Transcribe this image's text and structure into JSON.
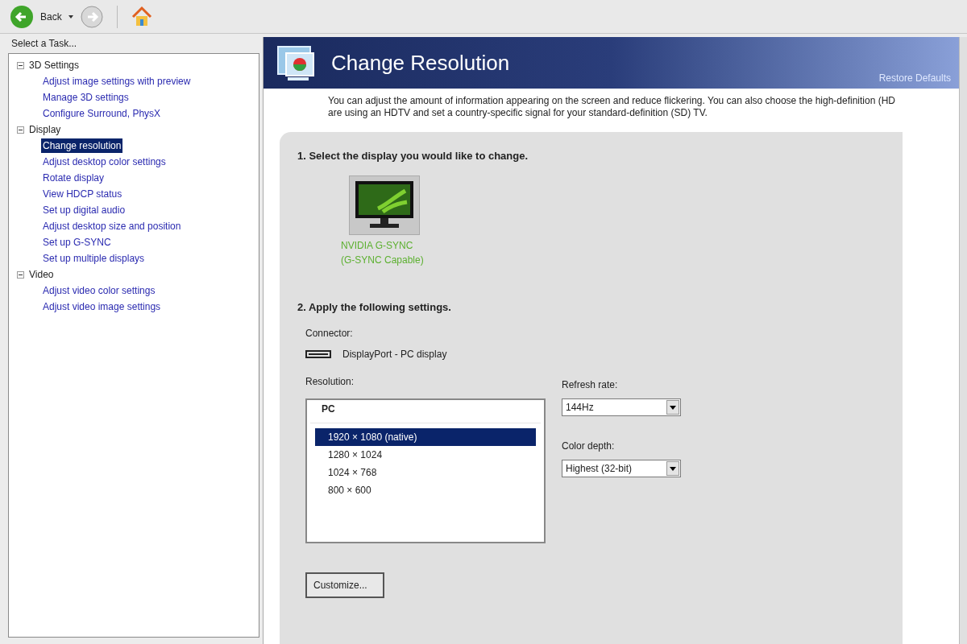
{
  "toolbar": {
    "back_label": "Back"
  },
  "task_panel": {
    "title": "Select a Task...",
    "tree": [
      {
        "label": "3D Settings",
        "expanded": true,
        "children": [
          {
            "label": "Adjust image settings with preview",
            "selected": false
          },
          {
            "label": "Manage 3D settings",
            "selected": false
          },
          {
            "label": "Configure Surround, PhysX",
            "selected": false
          }
        ]
      },
      {
        "label": "Display",
        "expanded": true,
        "children": [
          {
            "label": "Change resolution",
            "selected": true
          },
          {
            "label": "Adjust desktop color settings",
            "selected": false
          },
          {
            "label": "Rotate display",
            "selected": false
          },
          {
            "label": "View HDCP status",
            "selected": false
          },
          {
            "label": "Set up digital audio",
            "selected": false
          },
          {
            "label": "Adjust desktop size and position",
            "selected": false
          },
          {
            "label": "Set up G-SYNC",
            "selected": false
          },
          {
            "label": "Set up multiple displays",
            "selected": false
          }
        ]
      },
      {
        "label": "Video",
        "expanded": true,
        "children": [
          {
            "label": "Adjust video color settings",
            "selected": false
          },
          {
            "label": "Adjust video image settings",
            "selected": false
          }
        ]
      }
    ]
  },
  "page": {
    "title": "Change Resolution",
    "restore_link": "Restore Defaults",
    "description": [
      "You can adjust the amount of information appearing on the screen and reduce flickering. You can also choose the high-definition (HD",
      "are using an HDTV and set a country-specific signal for your standard-definition (SD) TV."
    ],
    "step1": "1. Select the display you would like to change.",
    "display": {
      "name": "NVIDIA G-SYNC",
      "subtitle": "(G-SYNC Capable)",
      "selected": true
    },
    "step2": "2. Apply the following settings.",
    "connector_label": "Connector:",
    "connector_value": "DisplayPort - PC display",
    "resolution_label": "Resolution:",
    "resolution_group": "PC",
    "resolutions": [
      {
        "label": "1920 × 1080 (native)",
        "selected": true
      },
      {
        "label": "1280 × 1024",
        "selected": false
      },
      {
        "label": "1024 × 768",
        "selected": false
      },
      {
        "label": "800 × 600",
        "selected": false
      }
    ],
    "refresh_label": "Refresh rate:",
    "refresh_value": "144Hz",
    "depth_label": "Color depth:",
    "depth_value": "Highest (32-bit)",
    "customize_button": "Customize..."
  }
}
